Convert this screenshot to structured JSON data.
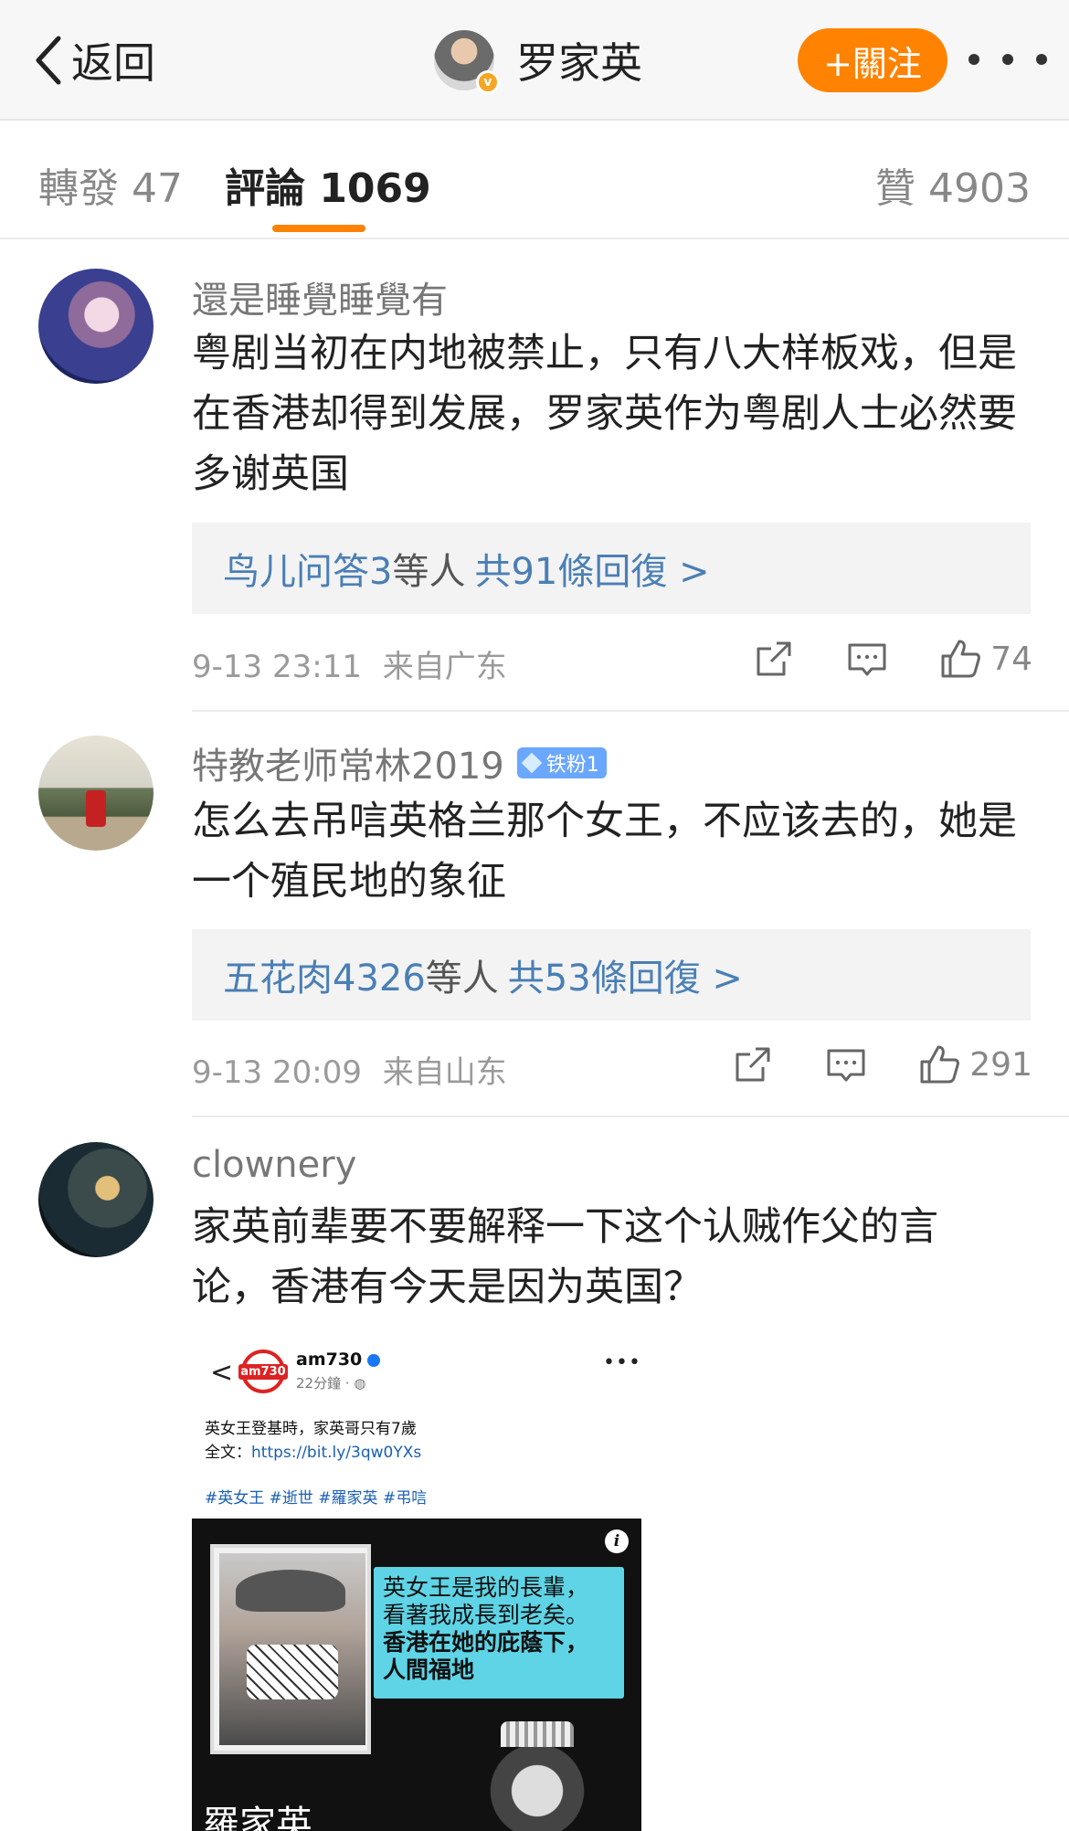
{
  "navbar": {
    "back_label": "返回",
    "title": "罗家英",
    "follow_label": "+關注"
  },
  "tabs": {
    "repost": "轉發 47",
    "comments": "評論 1069",
    "likes": "贊 4903"
  },
  "comments": [
    {
      "name": "還是睡覺睡覺有",
      "text": "粤剧当初在内地被禁止，只有八大样板戏，但是在香港却得到发展，罗家英作为粤剧人士必然要多谢英国",
      "reply_users": "鸟儿问答3",
      "reply_others": "等人",
      "reply_count": "共91條回復 >",
      "time": "9-13 23:11",
      "location": "来自广东",
      "likes": "74"
    },
    {
      "name": "特教老师常林2019",
      "badge": "铁粉1",
      "text": "怎么去吊唁英格兰那个女王，不应该去的，她是一个殖民地的象征",
      "reply_users": "五花肉4326",
      "reply_others": "等人",
      "reply_count": "共53條回復 >",
      "time": "9-13 20:09",
      "location": "来自山东",
      "likes": "291"
    },
    {
      "name": "clownery",
      "text": "家英前辈要不要解释一下这个认贼作父的言论，香港有今天是因为英国？"
    }
  ],
  "embed": {
    "back": "<",
    "logo_text": "am730",
    "account": "am730",
    "time": "22分鐘 · ",
    "line1": "英女王登基時，家英哥只有7歲",
    "line2_prefix": "全文：",
    "link": "https://bit.ly/3qw0YXs",
    "tags": "#英女王 #逝世 #羅家英 #弔唁",
    "bubble_line1": "英女王是我的長輩，",
    "bubble_line2": "看著我成長到老矣。",
    "bubble_line3": "香港在她的庇蔭下，",
    "bubble_line4": "人間福地",
    "caption": "羅家英"
  },
  "colors": {
    "accent": "#ff8200",
    "link": "#4a7fb5",
    "meta": "#9a9a9a"
  }
}
